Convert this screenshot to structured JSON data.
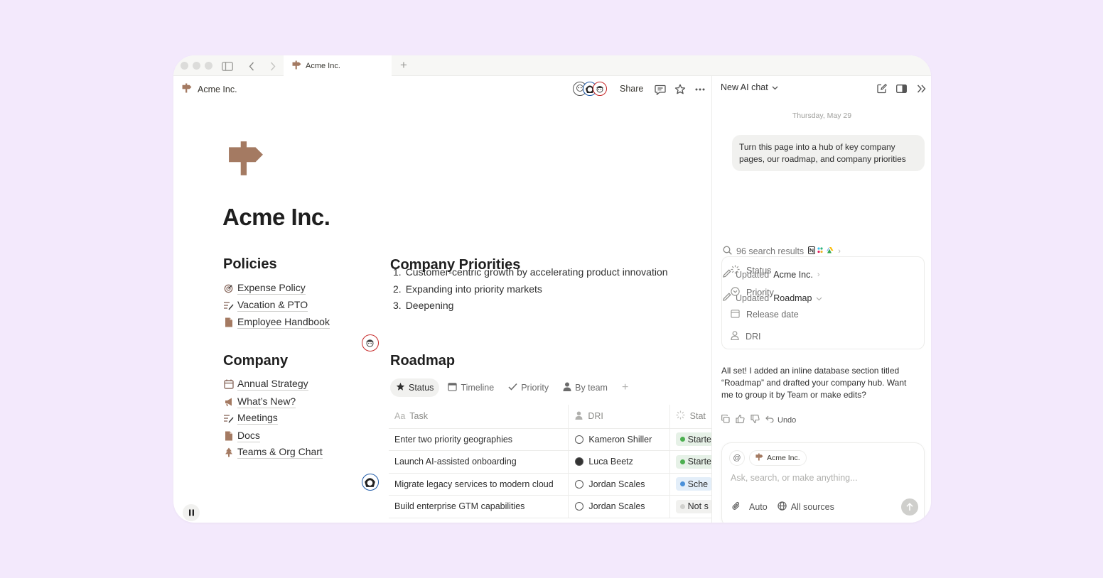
{
  "browser": {
    "tab_title": "Acme Inc."
  },
  "topbar": {
    "breadcrumb": "Acme Inc.",
    "share_label": "Share"
  },
  "page": {
    "title": "Acme Inc.",
    "policies": {
      "heading": "Policies",
      "items": [
        "Expense Policy",
        "Vacation & PTO",
        "Employee Handbook"
      ]
    },
    "company": {
      "heading": "Company",
      "items": [
        "Annual Strategy",
        "What’s New?",
        "Meetings",
        "Docs",
        "Teams & Org Chart"
      ]
    },
    "priorities": {
      "heading": "Company Priorities",
      "items": [
        {
          "num": "1.",
          "text": "Customer-centric growth by accelerating product innovation"
        },
        {
          "num": "2.",
          "text": "Expanding into priority markets"
        },
        {
          "num": "3.",
          "text": "Deepening"
        }
      ]
    },
    "roadmap": {
      "heading": "Roadmap",
      "views": [
        "Status",
        "Timeline",
        "Priority",
        "By team"
      ],
      "columns": {
        "task_prefix": "Aa",
        "task": "Task",
        "dri": "DRI",
        "status": "Stat"
      },
      "rows": [
        {
          "task": "Enter two priority geographies",
          "dri": "Kameron Shiller",
          "status": "Starte",
          "status_color": "#4caf50",
          "pill_bg": "#e6f1e7"
        },
        {
          "task": "Launch AI-assisted onboarding",
          "dri": "Luca Beetz",
          "status": "Starte",
          "status_color": "#4caf50",
          "pill_bg": "#e6f1e7"
        },
        {
          "task": "Migrate legacy services to modern cloud",
          "dri": "Jordan Scales",
          "status": "Sche",
          "status_color": "#4a90d9",
          "pill_bg": "#e3eef9"
        },
        {
          "task": "Build enterprise GTM capabilities",
          "dri": "Jordan Scales",
          "status": "Not s",
          "status_color": "#d0d0cd",
          "pill_bg": "#f1f1ef"
        }
      ]
    }
  },
  "chat": {
    "title": "New AI chat",
    "date": "Thursday, May 29",
    "user_message": "Turn this page into a hub of key company pages, our roadmap, and company priorities",
    "steps": {
      "search": "96 search results",
      "updated_prefix": "Updated",
      "updated_1": "Acme Inc.",
      "updated_2": "Roadmap"
    },
    "properties": [
      "Status",
      "Priority",
      "Release date",
      "DRI"
    ],
    "reply": "All set! I added an inline database section titled “Roadmap” and drafted your company hub. Want me to group it by Team or make edits?",
    "undo_label": "Undo",
    "input": {
      "at_symbol": "@",
      "context_chip": "Acme Inc.",
      "placeholder": "Ask, search, or make anything...",
      "auto_label": "Auto",
      "sources_label": "All sources"
    }
  },
  "colors": {
    "accent_brown": "#a47a62",
    "background": "#f3e9fc"
  }
}
